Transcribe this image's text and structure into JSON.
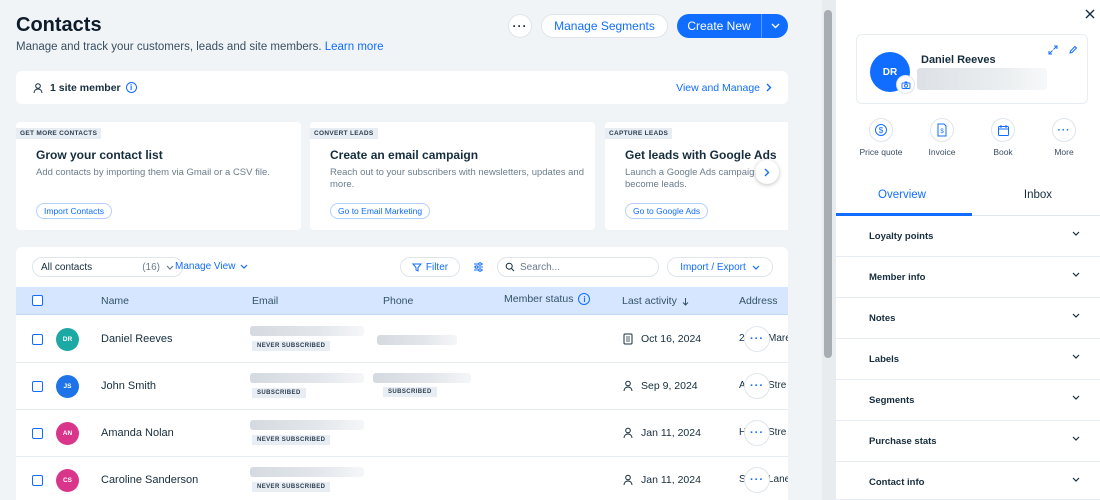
{
  "header": {
    "title": "Contacts",
    "subtitle": "Manage and track your customers, leads and site members.",
    "learn_more": "Learn more",
    "more_label": "···",
    "manage_segments": "Manage Segments",
    "create_new": "Create New"
  },
  "member_bar": {
    "count_label": "1 site member",
    "info_glyph": "i",
    "view_manage": "View and Manage"
  },
  "cards": [
    {
      "tag": "GET MORE CONTACTS",
      "title": "Grow your contact list",
      "description": "Add contacts by importing them via Gmail or a CSV file.",
      "button": "Import Contacts"
    },
    {
      "tag": "CONVERT LEADS",
      "title": "Create an email campaign",
      "description": "Reach out to your subscribers with newsletters, updates and more.",
      "button": "Go to Email Marketing"
    },
    {
      "tag": "CAPTURE LEADS",
      "title": "Get leads with Google Ads",
      "description": "Launch a Google Ads campaign to become leads.",
      "button": "Go to Google Ads"
    }
  ],
  "toolbar": {
    "view_select": "All contacts",
    "view_count": "(16)",
    "manage_view": "Manage View",
    "filter": "Filter",
    "search_placeholder": "Search...",
    "import_export": "Import / Export"
  },
  "table": {
    "columns": {
      "name": "Name",
      "email": "Email",
      "phone": "Phone",
      "member_status": "Member status",
      "last_activity": "Last activity",
      "address": "Address"
    },
    "rows": [
      {
        "initials": "DR",
        "avatar_color": "#1aa9a3",
        "name": "Daniel Reeves",
        "email_status": "NEVER SUBSCRIBED",
        "phone_status": "",
        "activity_icon": "document-icon",
        "last_activity": "Oct 16, 2024",
        "address_start": "2",
        "address_end": "Mare"
      },
      {
        "initials": "JS",
        "avatar_color": "#1f73e8",
        "name": "John Smith",
        "email_status": "SUBSCRIBED",
        "phone_status": "SUBSCRIBED",
        "activity_icon": "person-icon",
        "last_activity": "Sep 9, 2024",
        "address_start": "A",
        "address_end": "Stre"
      },
      {
        "initials": "AN",
        "avatar_color": "#d9368b",
        "name": "Amanda Nolan",
        "email_status": "NEVER SUBSCRIBED",
        "phone_status": "",
        "activity_icon": "person-icon",
        "last_activity": "Jan 11, 2024",
        "address_start": "H",
        "address_end": "Stre"
      },
      {
        "initials": "CS",
        "avatar_color": "#d9368b",
        "name": "Caroline Sanderson",
        "email_status": "NEVER SUBSCRIBED",
        "phone_status": "",
        "activity_icon": "person-icon",
        "last_activity": "Jan 11, 2024",
        "address_start": "S",
        "address_end": "Lane"
      }
    ]
  },
  "panel": {
    "initials": "DR",
    "name": "Daniel Reeves",
    "actions": [
      {
        "label": "Price quote",
        "icon": "dollar-icon"
      },
      {
        "label": "Invoice",
        "icon": "invoice-icon"
      },
      {
        "label": "Book",
        "icon": "calendar-icon"
      },
      {
        "label": "More",
        "icon": "more-icon"
      }
    ],
    "tabs": {
      "overview": "Overview",
      "inbox": "Inbox"
    },
    "sections": [
      "Loyalty points",
      "Member info",
      "Notes",
      "Labels",
      "Segments",
      "Purchase stats",
      "Contact info"
    ]
  },
  "colors": {
    "accent": "#116dff",
    "header_row": "#d6e6fe",
    "background": "#f0f4f7"
  }
}
